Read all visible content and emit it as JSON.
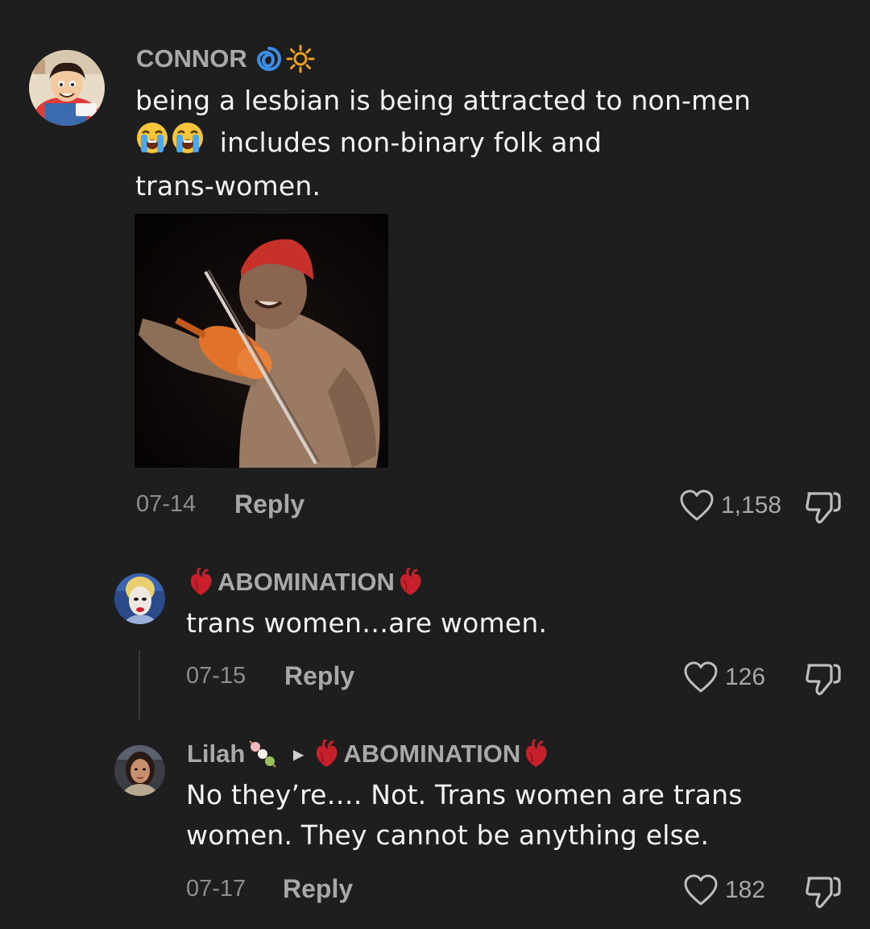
{
  "comments": [
    {
      "username": "CONNOR",
      "username_icons": [
        "cyclone-icon",
        "sun-icon"
      ],
      "text_line1": "being a lesbian is being attracted to non-men",
      "text_line2_emojis": [
        "loudly-crying-face-icon",
        "loudly-crying-face-icon"
      ],
      "text_line2": "includes non-binary folk and",
      "text_line3": "trans-women.",
      "date": "07-14",
      "reply_label": "Reply",
      "likes": "1,158"
    },
    {
      "username": "ABOMINATION",
      "username_icons": [
        "anatomical-heart-icon",
        "anatomical-heart-icon"
      ],
      "text_line1": "trans women…are women.",
      "date": "07-15",
      "reply_label": "Reply",
      "likes": "126"
    },
    {
      "username": "Lilah",
      "username_icons": [
        "dango-icon"
      ],
      "reply_to_arrow": "▸",
      "reply_to": "ABOMINATION",
      "text_line1": "No they’re…. Not. Trans women are trans",
      "text_line2": "women. They cannot be anything else.",
      "date": "07-17",
      "reply_label": "Reply",
      "likes": "182"
    }
  ],
  "colors": {
    "background": "#1e1e1e",
    "username": "#a9a9a9",
    "text": "#f4f4f4",
    "meta": "#8e8e8e"
  }
}
